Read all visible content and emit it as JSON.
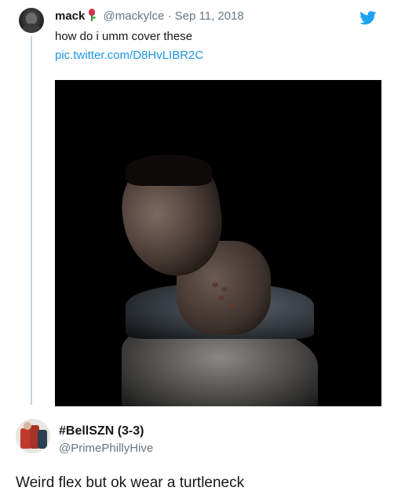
{
  "tweet1": {
    "name": "mack",
    "name_emoji_icon": "rose-icon",
    "handle": "@mackylce",
    "separator": "·",
    "date": "Sep 11, 2018",
    "text": "how do i umm cover these",
    "link": "pic.twitter.com/D8HvLIBR2C",
    "platform_icon": "twitter-bird-icon"
  },
  "tweet2": {
    "name": "#BellSZN (3-3)",
    "handle": "@PrimePhillyHive",
    "text": "Weird flex but ok wear a turtleneck"
  },
  "colors": {
    "link": "#1b95e0",
    "secondary_text": "#657786",
    "primary_text": "#14171a",
    "twitter_blue": "#1da1f2"
  }
}
